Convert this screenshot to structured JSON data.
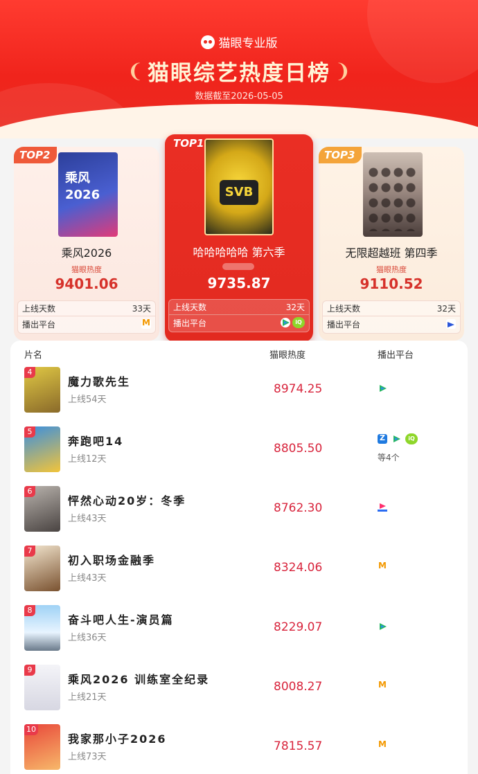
{
  "header": {
    "brand": "猫眼专业版",
    "title": "猫眼综艺热度日榜",
    "date": "数据截至2026-05-05"
  },
  "podium": [
    {
      "badge": "TOP2",
      "poster_text": "乘风\n2026",
      "name": "乘风2026",
      "heat_label": "猫眼热度",
      "heat": "9401.06",
      "days_label": "上线天数",
      "days": "33天",
      "platform_label": "播出平台",
      "platforms": [
        "mango"
      ]
    },
    {
      "badge": "TOP1",
      "poster_text": "SVB",
      "name": "哈哈哈哈哈 第六季",
      "heat_label": "",
      "heat": "9735.87",
      "days_label": "上线天数",
      "days": "32天",
      "platform_label": "播出平台",
      "platforms": [
        "tencent",
        "iqiyi"
      ]
    },
    {
      "badge": "TOP3",
      "poster_text": "",
      "name": "无限超越班 第四季",
      "heat_label": "猫眼热度",
      "heat": "9110.52",
      "days_label": "上线天数",
      "days": "32天",
      "platform_label": "播出平台",
      "platforms": [
        "bilibili"
      ]
    }
  ],
  "list": {
    "headers": {
      "name": "片名",
      "heat": "猫眼热度",
      "platform": "播出平台"
    },
    "rows": [
      {
        "rank": "4",
        "title": "魔力歌先生",
        "days": "上线54天",
        "heat": "8974.25",
        "platforms": [
          "tencent"
        ],
        "more": "",
        "thumb_color": "#d8c23a"
      },
      {
        "rank": "5",
        "title": "奔跑吧14",
        "days": "上线12天",
        "heat": "8805.50",
        "platforms": [
          "zj",
          "tencent",
          "iqiyi"
        ],
        "more": "等4个",
        "thumb_color": "#3a7fd8"
      },
      {
        "rank": "6",
        "title": "怦然心动20岁：冬季",
        "days": "上线43天",
        "heat": "8762.30",
        "platforms": [
          "youku"
        ],
        "more": "",
        "thumb_color": "#7a7a7a"
      },
      {
        "rank": "7",
        "title": "初入职场金融季",
        "days": "上线43天",
        "heat": "8324.06",
        "platforms": [
          "mango"
        ],
        "more": "",
        "thumb_color": "#c99a5a"
      },
      {
        "rank": "8",
        "title": "奋斗吧人生-演员篇",
        "days": "上线36天",
        "heat": "8229.07",
        "platforms": [
          "tencent"
        ],
        "more": "",
        "thumb_color": "#6aaee0"
      },
      {
        "rank": "9",
        "title": "乘风2026 训练室全纪录",
        "days": "上线21天",
        "heat": "8008.27",
        "platforms": [
          "mango"
        ],
        "more": "",
        "thumb_color": "#e9e9ef"
      },
      {
        "rank": "10",
        "title": "我家那小子2026",
        "days": "上线73天",
        "heat": "7815.57",
        "platforms": [
          "mango"
        ],
        "more": "",
        "thumb_color": "#d8413a"
      }
    ]
  }
}
